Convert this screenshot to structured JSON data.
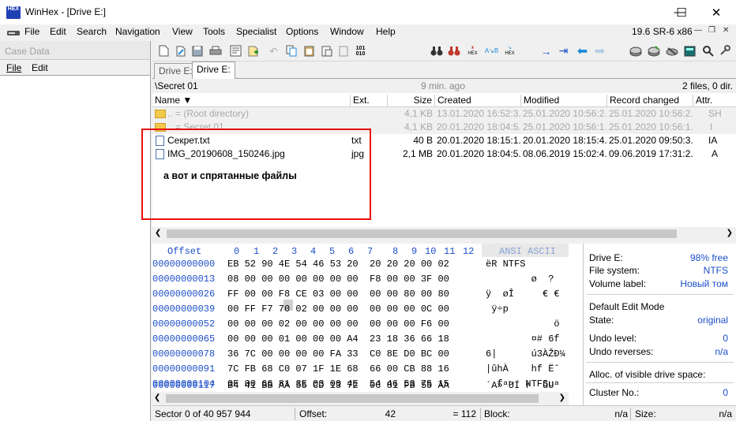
{
  "window": {
    "title": "WinHex - [Drive E:]",
    "icon_text_top": "HEX",
    "icon_text_bottom": "",
    "minimize": "—",
    "maximize": "☐",
    "close": "✕"
  },
  "menubar": {
    "items": [
      "File",
      "Edit",
      "Search",
      "Navigation",
      "View",
      "Tools",
      "Specialist",
      "Options",
      "Window",
      "Help"
    ],
    "version": "19.6 SR-6 x86"
  },
  "case_panel": {
    "title": "Case Data",
    "menu": [
      "File",
      "Edit"
    ]
  },
  "tabs": [
    "Drive E:",
    "Drive E:"
  ],
  "pathbar": {
    "path": "\\Secret 01",
    "age": "9 min. ago",
    "count": "2 files, 0 dir."
  },
  "file_list": {
    "headers": [
      "Name",
      "Ext.",
      "Size",
      "Created",
      "Modified",
      "Record changed",
      "Attr."
    ],
    "rows": [
      {
        "name": "..  =  (Root directory)",
        "ext": "",
        "size": "4,1 KB",
        "created": "13.01.2020  16:52:3...",
        "modified": "25.01.2020  10:56:2...",
        "record": "25.01.2020  10:56:2...",
        "attr": "SH",
        "kind": "folder",
        "dim": true
      },
      {
        "name": "..  =  Secret 01",
        "ext": "",
        "size": "4,1 KB",
        "created": "20.01.2020  18:04:5...",
        "modified": "25.01.2020  10:56:1...",
        "record": "25.01.2020  10:56:1...",
        "attr": "I",
        "kind": "folder",
        "dim": true
      },
      {
        "name": "Секрет.txt",
        "ext": "txt",
        "size": "40 B",
        "created": "20.01.2020  18:15:1...",
        "modified": "20.01.2020  18:15:4...",
        "record": "25.01.2020  09:50:3...",
        "attr": "IA",
        "kind": "file",
        "dim": false
      },
      {
        "name": "IMG_20190608_150246.jpg",
        "ext": "jpg",
        "size": "2,1 MB",
        "created": "20.01.2020  18:04:5...",
        "modified": "08.06.2019  15:02:4...",
        "record": "09.06.2019  17:31:2...",
        "attr": "A",
        "kind": "file",
        "dim": false
      }
    ]
  },
  "annotation": {
    "text": "а вот и спрятанные файлы",
    "color": "#e81010"
  },
  "hex": {
    "offset_header": "Offset",
    "col_headers": [
      "0",
      "1",
      "2",
      "3",
      "4",
      "5",
      "6",
      "7",
      "8",
      "9",
      "10",
      "11",
      "12"
    ],
    "ansi_header": "ANSI ASCII",
    "rows": [
      {
        "offset": "00000000000",
        "bytes": "EB 52 90 4E 54 46 53 20  20 20 20 00 02",
        "ascii": "ëR NTFS"
      },
      {
        "offset": "00000000013",
        "bytes": "08 00 00 00 00 00 00 00  F8 00 00 3F 00",
        "ascii": "        ø  ?"
      },
      {
        "offset": "00000000026",
        "bytes": "FF 00 00 F8 CE 03 00 00  00 00 80 00 80",
        "ascii": "ÿ  øÎ     € €"
      },
      {
        "offset": "00000000039",
        "bytes": "00 FF F7 70 02 00 00 00  00 00 00 0C 00",
        "ascii": " ÿ÷p"
      },
      {
        "offset": "00000000052",
        "bytes": "00 00 00 02 00 00 00 00  00 00 00 F6 00",
        "ascii": "            ö"
      },
      {
        "offset": "00000000065",
        "bytes": "00 00 00 01 00 00 00 A4  23 18 36 66 18",
        "ascii": "        ¤# 6f"
      },
      {
        "offset": "00000000078",
        "bytes": "36 7C 00 00 00 00 FA 33  C0 8E D0 BC 00",
        "ascii": "6|      ú3ÀŽÐ¼"
      },
      {
        "offset": "00000000091",
        "bytes": "7C FB 68 C0 07 1F 1E 68  66 00 CB 88 16",
        "ascii": "|ûhÀ    hf Ëˆ"
      },
      {
        "offset": "00000000104",
        "bytes": "0E 00 66 81 3E 03 00 4E  54 46 53 75 15",
        "ascii": "  f >  NTFSu"
      },
      {
        "offset": "00000000117",
        "bytes": "B4 41 BB AA 55 CD 13 72  0C 81 FB 55 AA",
        "ascii": "´A»ªUÍ r  ûUª"
      }
    ]
  },
  "info": {
    "drive_label": "Drive E:",
    "drive_value": "98% free",
    "fs_label": "File system:",
    "fs_value": "NTFS",
    "vol_label": "Volume label:",
    "vol_value": "Новый том",
    "mode_title": "Default Edit Mode",
    "state_label": "State:",
    "state_value": "original",
    "undo_label": "Undo level:",
    "undo_value": "0",
    "undorev_label": "Undo reverses:",
    "undorev_value": "n/a",
    "alloc_label": "Alloc. of visible drive space:",
    "cluster_label": "Cluster No.:",
    "cluster_value": "0"
  },
  "status": {
    "sector": "Sector 0 of 40 957 944",
    "offset_label": "Offset:",
    "offset_value": "42",
    "eq_value": "= 112",
    "block_label": "Block:",
    "block_value": "n/a",
    "size_label": "Size:",
    "size_value": "n/a"
  },
  "colors": {
    "accent_blue": "#1c4ec9",
    "folder": "#f2c94c",
    "toolbar_blue": "#1f8ad8",
    "toolbar_red": "#c0392b"
  }
}
